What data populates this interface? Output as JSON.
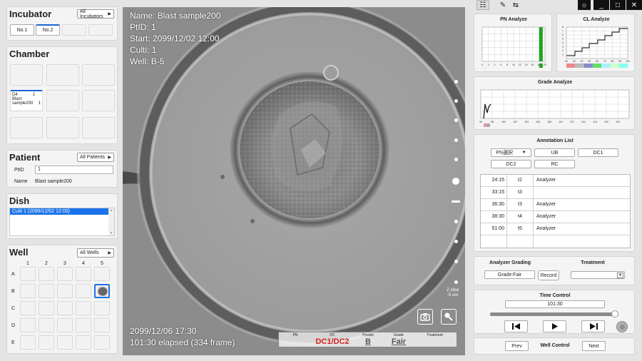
{
  "incubator": {
    "title": "Incubator",
    "filter": "All Incubators",
    "items": [
      "No.1",
      "No.2"
    ]
  },
  "chamber": {
    "title": "Chamber",
    "slot": {
      "day": "D4",
      "num": "1",
      "name1": "Blast",
      "name2": "sample200",
      "count": "1"
    }
  },
  "patient": {
    "title": "Patient",
    "filter": "All Patients",
    "ptid_label": "PtID",
    "ptid_value": "1",
    "name_label": "Name",
    "name_value": "Blast sample200"
  },
  "dish": {
    "title": "Dish",
    "selected": "Culti 1 (2099/12/02 12:00)"
  },
  "well": {
    "title": "Well",
    "filter": "All Wells",
    "cols": [
      "1",
      "2",
      "3",
      "4",
      "5"
    ],
    "rows": [
      "A",
      "B",
      "C",
      "D",
      "E"
    ]
  },
  "viewer": {
    "info": [
      "Name: Blast sample200",
      "PtID: 1",
      "Start: 2099/12/02  12:00",
      "Culti: 1",
      "Well: B-5"
    ],
    "date": "2099/12/06  17:30",
    "elapsed": "101:30 elapsed (334 frame)",
    "zslice": "Z slice",
    "zval": "-5 um",
    "bar": {
      "h_pn": "PN",
      "h_dc": "DC",
      "h_predict": "Predict",
      "h_grade": "Grade",
      "h_treatment": "Treatment",
      "v_dc": "DC1/DC2",
      "v_predict": "B",
      "v_grade": "Fair"
    }
  },
  "topbar": {
    "icons": [
      "list-icon",
      "pen-icon",
      "swap-icon",
      "brightness-icon",
      "minimize-icon",
      "maximize-icon",
      "close-icon"
    ],
    "min": "_",
    "max": "□",
    "close": "✕",
    "swap": "⇆",
    "sun": "☼",
    "pen": "✎",
    "list": "☷"
  },
  "pn": {
    "title": "PN Analyze",
    "xt": [
      "0",
      "2",
      "4",
      "6",
      "8",
      "10",
      "12",
      "14",
      "16",
      "18",
      "20"
    ],
    "bars": [
      {
        "x": 18.6,
        "color": "#1ea51e"
      }
    ]
  },
  "cl": {
    "title": "CL Analyze",
    "yt": [
      "1",
      "2",
      "3",
      "4",
      "5",
      "6",
      "7",
      "8"
    ],
    "xt": [
      "20",
      "30",
      "40",
      "50",
      "60",
      "70",
      "80",
      "90",
      "100"
    ]
  },
  "grade": {
    "title": "Grade Analyze",
    "xt": [
      "96",
      "98",
      "100",
      "102",
      "104",
      "106",
      "108",
      "110",
      "112",
      "114",
      "116",
      "118",
      "120"
    ]
  },
  "annotation": {
    "title": "Annotation List",
    "dropdown": "PN選択",
    "buttons": [
      "UB",
      "DC1",
      "DC2",
      "RC"
    ],
    "rows": [
      {
        "time": "24:15",
        "ev": "t2",
        "src": "Analyzer"
      },
      {
        "time": "33:15",
        "ev": "t3",
        "src": ""
      },
      {
        "time": "36:30",
        "ev": "t3",
        "src": "Analyzer"
      },
      {
        "time": "38:30",
        "ev": "t4",
        "src": "Analyzer"
      },
      {
        "time": "51:00",
        "ev": "t5",
        "src": "Analyzer"
      }
    ]
  },
  "grading": {
    "title": "Analyzer Grading",
    "value": "Grade:Fair",
    "record": "Record",
    "treatment": "Treatment"
  },
  "time": {
    "title": "Time Control",
    "value": "101:30",
    "progress": 0.97
  },
  "wellctl": {
    "prev": "Prev",
    "label": "Well Control",
    "next": "Next"
  }
}
